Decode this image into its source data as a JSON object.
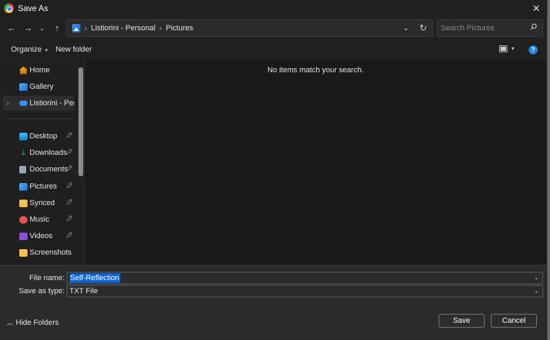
{
  "window": {
    "title": "Save As"
  },
  "nav": {
    "breadcrumb": [
      "Listiorini - Personal",
      "Pictures"
    ],
    "search_placeholder": "Search Pictures"
  },
  "commands": {
    "organize": "Organize",
    "new_folder": "New folder"
  },
  "sidebar": {
    "items": [
      {
        "label": "Home",
        "icon": "home-icon",
        "pinned": false
      },
      {
        "label": "Gallery",
        "icon": "gallery-icon",
        "pinned": false
      },
      {
        "label": "Listiorini - Personal",
        "icon": "onedrive-icon",
        "pinned": false
      },
      {
        "label": "Desktop",
        "icon": "desktop-icon",
        "pinned": true
      },
      {
        "label": "Downloads",
        "icon": "download-icon",
        "pinned": true
      },
      {
        "label": "Documents",
        "icon": "documents-icon",
        "pinned": true
      },
      {
        "label": "Pictures",
        "icon": "pictures-icon",
        "pinned": true
      },
      {
        "label": "Synced",
        "icon": "folder-icon",
        "pinned": true
      },
      {
        "label": "Music",
        "icon": "music-icon",
        "pinned": true
      },
      {
        "label": "Videos",
        "icon": "videos-icon",
        "pinned": true
      },
      {
        "label": "Screenshots",
        "icon": "folder-icon",
        "pinned": false
      }
    ]
  },
  "content": {
    "empty_message": "No items match your search."
  },
  "footer": {
    "file_name_label": "File name:",
    "file_name_value": "Self-Reflection",
    "save_as_type_label": "Save as type:",
    "save_as_type_value": "TXT File",
    "hide_folders": "Hide Folders",
    "save_button": "Save",
    "cancel_button": "Cancel"
  },
  "colors": {
    "accent": "#0a64d8",
    "help": "#1e88e5",
    "background": "#202020"
  }
}
